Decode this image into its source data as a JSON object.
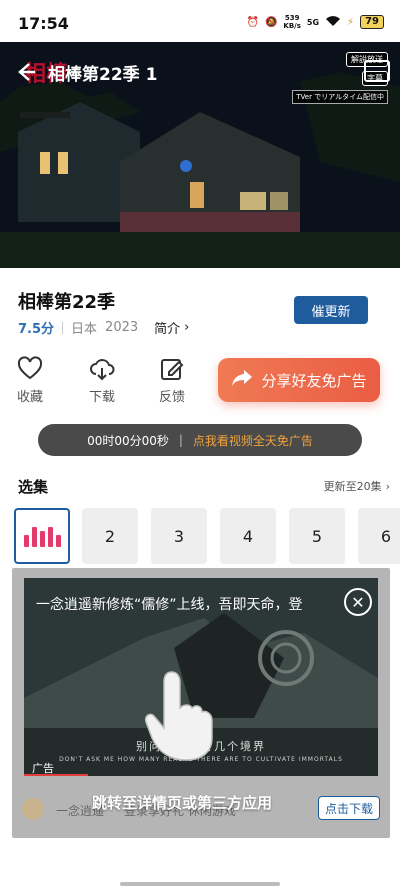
{
  "status_bar": {
    "time": "17:54",
    "net_speed_value": "539",
    "net_speed_unit": "KB/s",
    "signal_label": "5G",
    "battery": "79"
  },
  "video": {
    "title": "相棒第22季 1",
    "logo_text": "相棒",
    "badge_commentary": "解説放送",
    "badge_subtitle": "字幕",
    "badge_tver": "TVer でリアルタイム配信中"
  },
  "show": {
    "title": "相棒第22季",
    "rating": "7.5分",
    "region": "日本",
    "year": "2023",
    "intro_label": "简介",
    "update_button_label": "催更新"
  },
  "actions": {
    "favorite_label": "收藏",
    "download_label": "下载",
    "feedback_label": "反馈",
    "share_label": "分享好友免广告"
  },
  "timer": {
    "value": "00时00分00秒",
    "divider": "|",
    "promo": "点我看视频全天免广告"
  },
  "episodes": {
    "title": "选集",
    "update_status": "更新至20集",
    "items": [
      "2",
      "3",
      "4",
      "5",
      "6"
    ]
  },
  "ad": {
    "headline": "一念逍遥新修炼“儒修”上线，吾即天命，登",
    "subtitle_cn": "别问我修仙有几个境界",
    "subtitle_en": "DON'T ASK ME HOW MANY REALMS THERE ARE TO CULTIVATE IMMORTALS",
    "tag": "广告",
    "app_name": "一念逍遥",
    "app_tags": "登录享好礼   休闲游戏",
    "jump_text": "跳转至详情页或第三方应用",
    "download_label": "点击下载",
    "progress": 0.18
  },
  "colors": {
    "accent_blue": "#1f5c9e",
    "share_gradient_start": "#f07a54",
    "share_gradient_end": "#ea5d44",
    "promo_orange": "#f3a23b",
    "playing_pink": "#e43b6a"
  }
}
